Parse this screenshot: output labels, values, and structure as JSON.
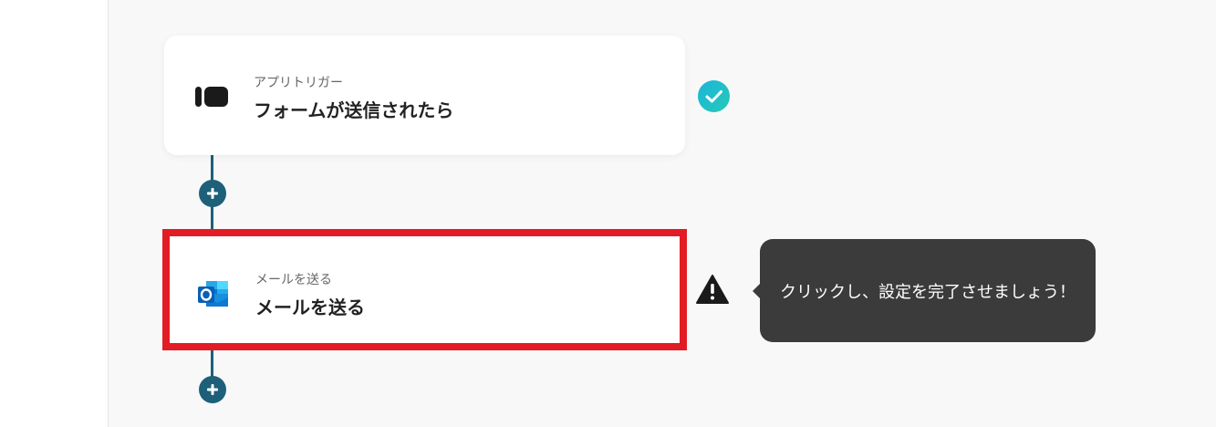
{
  "flow": {
    "trigger": {
      "label": "アプリトリガー",
      "title": "フォームが送信されたら",
      "icon": "form-app-icon",
      "status": "complete",
      "status_icon": "check-circle-icon"
    },
    "action": {
      "label": "メールを送る",
      "title": "メールを送る",
      "icon": "outlook-icon",
      "status": "incomplete",
      "status_icon": "warning-icon",
      "highlight_color": "#e21c24"
    },
    "tooltip": {
      "text": "クリックし、設定を完了させましょう！"
    },
    "add_step_icon": "plus-icon"
  },
  "colors": {
    "connector": "#1e5f79",
    "check_gradient_start": "#1ab6d8",
    "check_gradient_end": "#27c9b8",
    "tooltip_bg": "#3b3b3b",
    "canvas_bg": "#f8f8f8"
  }
}
